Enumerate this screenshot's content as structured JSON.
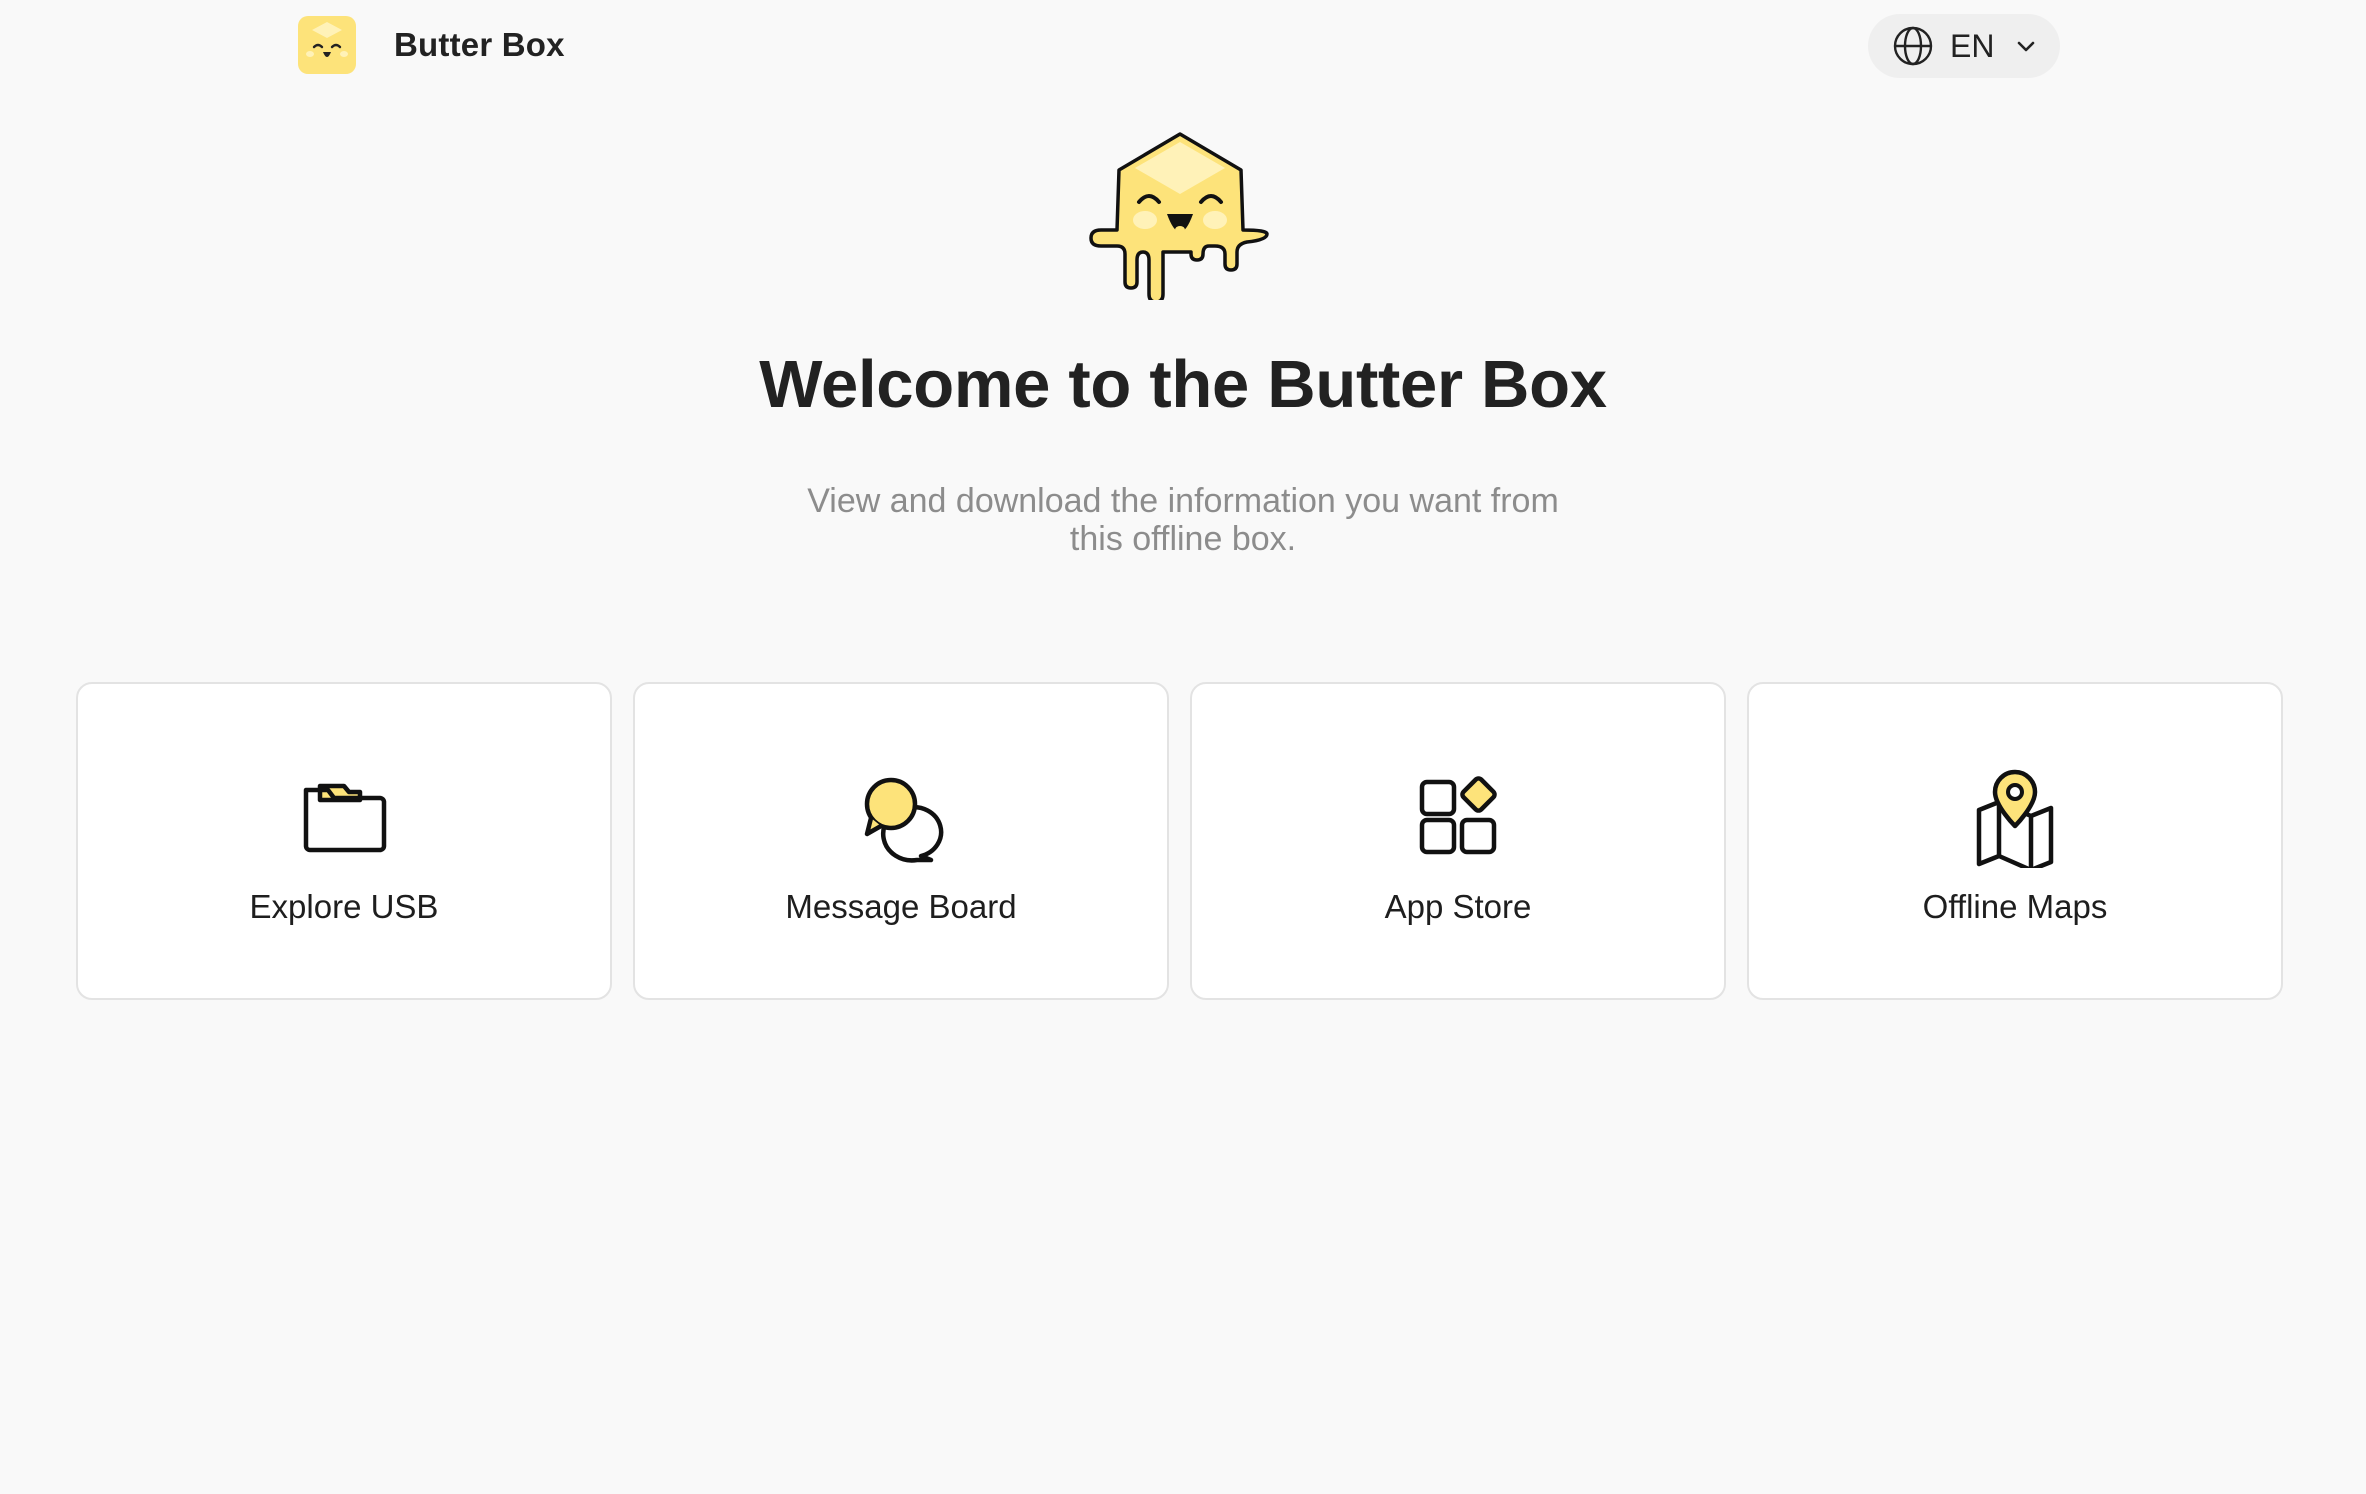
{
  "header": {
    "brand_name": "Butter Box",
    "logo_icon": "butter-logo-icon",
    "language": {
      "icon": "globe-icon",
      "selected": "EN",
      "chevron_icon": "chevron-down-icon"
    }
  },
  "hero": {
    "mascot_icon": "butter-mascot-icon",
    "title": "Welcome to the Butter Box",
    "subtitle": "View and download the information you want from this offline box."
  },
  "cards": [
    {
      "label": "Explore USB",
      "icon": "folder-icon"
    },
    {
      "label": "Message Board",
      "icon": "chat-bubbles-icon"
    },
    {
      "label": "App Store",
      "icon": "apps-grid-icon"
    },
    {
      "label": "Offline Maps",
      "icon": "map-pin-icon"
    }
  ],
  "colors": {
    "background": "#f9f9f9",
    "butter_yellow": "#fde37a",
    "butter_light": "#fff2b8",
    "text_dark": "#222222",
    "text_muted": "#8c8c8c",
    "card_border": "#e3e3e3"
  }
}
